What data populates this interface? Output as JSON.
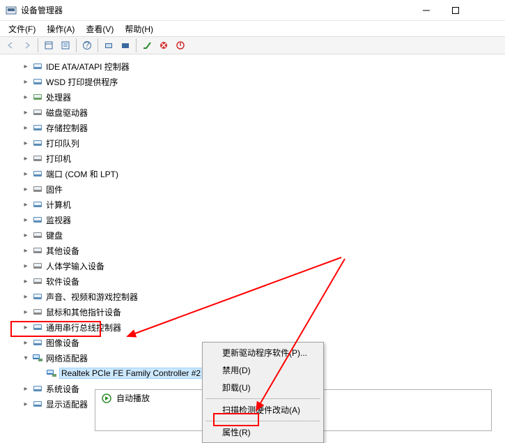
{
  "window": {
    "title": "设备管理器"
  },
  "menubar": {
    "file": "文件(F)",
    "action": "操作(A)",
    "view": "查看(V)",
    "help": "帮助(H)"
  },
  "tree": {
    "items": [
      {
        "label": "IDE ATA/ATAPI 控制器",
        "iconColor": "#5b8db8"
      },
      {
        "label": "WSD 打印提供程序",
        "iconColor": "#5b8db8"
      },
      {
        "label": "处理器",
        "iconColor": "#6aa060"
      },
      {
        "label": "磁盘驱动器",
        "iconColor": "#888"
      },
      {
        "label": "存储控制器",
        "iconColor": "#5b8db8"
      },
      {
        "label": "打印队列",
        "iconColor": "#5b8db8"
      },
      {
        "label": "打印机",
        "iconColor": "#888"
      },
      {
        "label": "端口 (COM 和 LPT)",
        "iconColor": "#5b8db8"
      },
      {
        "label": "固件",
        "iconColor": "#888"
      },
      {
        "label": "计算机",
        "iconColor": "#5b8db8"
      },
      {
        "label": "监视器",
        "iconColor": "#5b8db8"
      },
      {
        "label": "键盘",
        "iconColor": "#888"
      },
      {
        "label": "其他设备",
        "iconColor": "#888"
      },
      {
        "label": "人体学输入设备",
        "iconColor": "#888"
      },
      {
        "label": "软件设备",
        "iconColor": "#888"
      },
      {
        "label": "声音、视频和游戏控制器",
        "iconColor": "#5b8db8"
      },
      {
        "label": "鼠标和其他指针设备",
        "iconColor": "#888"
      },
      {
        "label": "通用串行总线控制器",
        "iconColor": "#5b8db8"
      },
      {
        "label": "图像设备",
        "iconColor": "#5b8db8"
      }
    ],
    "networkAdapters": {
      "label": "网络适配器",
      "child": "Realtek PCIe FE Family Controller #2"
    },
    "after": [
      {
        "label": "系统设备",
        "iconColor": "#5b8db8"
      },
      {
        "label": "显示适配器",
        "iconColor": "#5b8db8"
      }
    ]
  },
  "contextMenu": {
    "updateDriver": "更新驱动程序软件(P)...",
    "disable": "禁用(D)",
    "uninstall": "卸载(U)",
    "scanHardware": "扫描检测硬件改动(A)",
    "properties": "属性(R)"
  },
  "bottomPanel": {
    "autoplay": "自动播放"
  }
}
